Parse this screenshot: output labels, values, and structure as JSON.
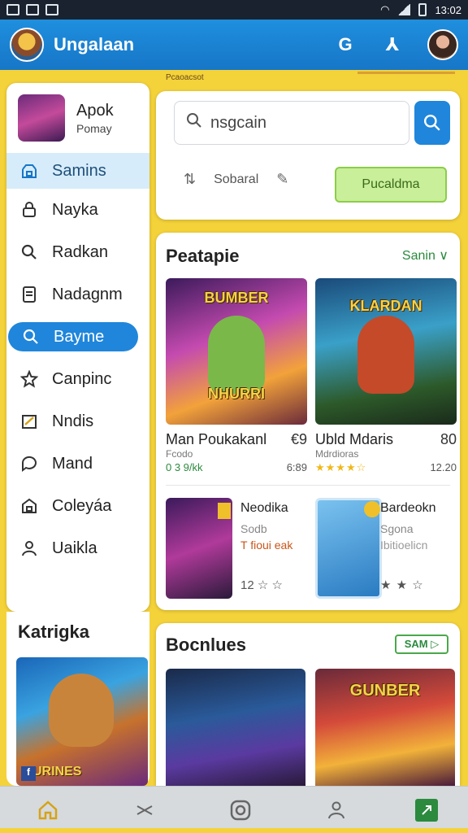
{
  "status_bar": {
    "time": "13:02"
  },
  "app_bar": {
    "title": "Ungalaan",
    "action_g": "G",
    "action_share": "⅄"
  },
  "banner": {
    "text": "Pcaoacsot"
  },
  "sidebar": {
    "profile": {
      "name": "Apok",
      "subtitle": "Pomay"
    },
    "items": [
      {
        "label": "Samins",
        "icon": "grid-icon",
        "state": "selected"
      },
      {
        "label": "Nayka",
        "icon": "lock-icon",
        "state": ""
      },
      {
        "label": "Radkan",
        "icon": "search-icon",
        "state": ""
      },
      {
        "label": "Nadagnm",
        "icon": "document-icon",
        "state": ""
      },
      {
        "label": "Bayme",
        "icon": "search-icon",
        "state": "active"
      },
      {
        "label": "Canpinc",
        "icon": "star-icon",
        "state": ""
      },
      {
        "label": "Nndis",
        "icon": "edit-icon",
        "state": ""
      },
      {
        "label": "Mand",
        "icon": "chat-icon",
        "state": ""
      },
      {
        "label": "Coleyáa",
        "icon": "folder-icon",
        "state": ""
      },
      {
        "label": "Uaikla",
        "icon": "user-icon",
        "state": ""
      }
    ],
    "section_title": "Katrigka",
    "promo_title": "URINES"
  },
  "search": {
    "value": "nsgcain",
    "filter_label": "Sobaral",
    "apply_label": "Pucaldma"
  },
  "featured": {
    "title": "Peatapie",
    "more_label": "Sanin ∨",
    "games": [
      {
        "title": "Man Poukakanl",
        "subtitle": "Fcodo",
        "rating_text": "0 3 9/kk",
        "meta": "6:89",
        "price": "€9",
        "logo_top": "BUMBER",
        "logo_bottom": "NHURRI"
      },
      {
        "title": "Ubld Mdaris",
        "subtitle": "Mdrdioras",
        "rating_text": "★★★★☆",
        "meta": "12.20",
        "price": "80",
        "logo_top": "KLARDAN",
        "logo_bottom": ""
      }
    ],
    "mini_games": [
      {
        "title": "Neodika",
        "subtitle": "Sodb",
        "tag": "T fioui eak",
        "rating": "12 ☆ ☆"
      },
      {
        "title": "Bardeokn",
        "subtitle": "Sgona",
        "tag": "Ibitioelicn",
        "rating": "★ ★ ☆"
      }
    ]
  },
  "section2": {
    "title": "Bocnlues",
    "pill_label": "SAM ▷",
    "games": [
      {
        "logo": ""
      },
      {
        "logo": "GUNBER"
      }
    ]
  },
  "bottom_nav": [
    {
      "icon": "home-icon"
    },
    {
      "icon": "shuffle-icon"
    },
    {
      "icon": "circle-icon"
    },
    {
      "icon": "person-icon"
    },
    {
      "icon": "send-icon"
    }
  ],
  "colors": {
    "accent_blue": "#1f86db",
    "accent_green": "#2b8a3e",
    "background_yellow": "#f4d23a"
  }
}
